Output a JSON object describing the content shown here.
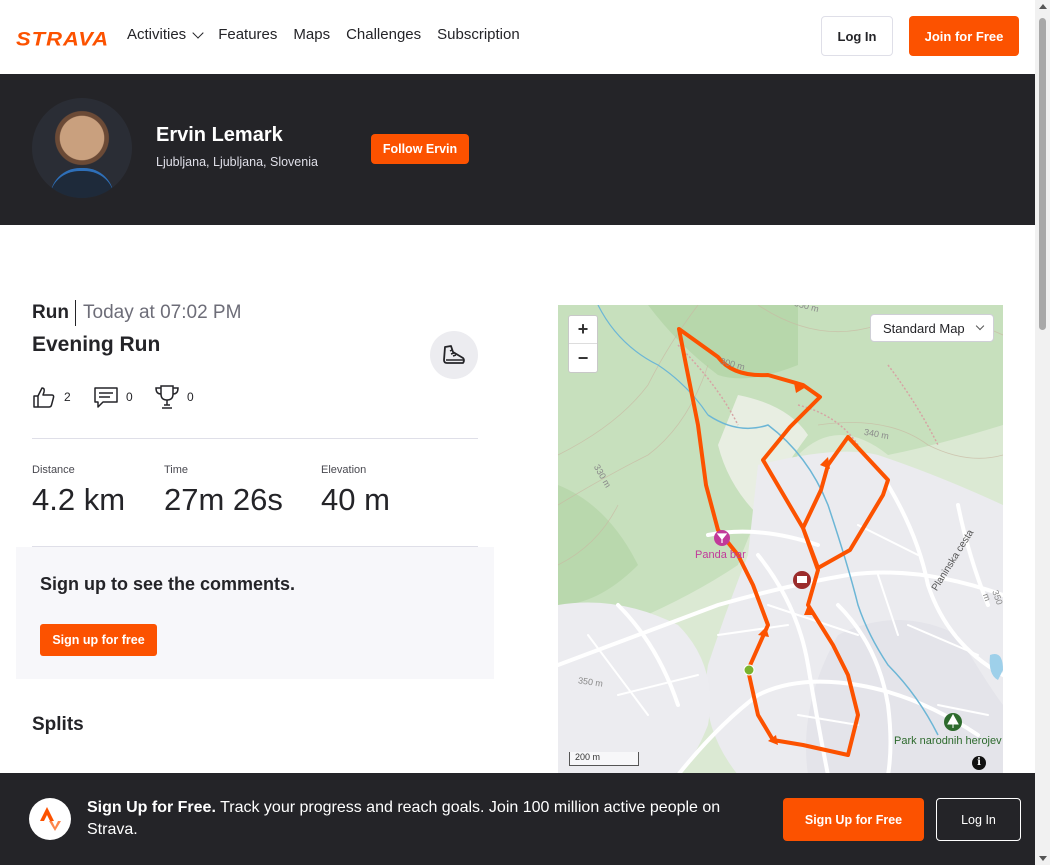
{
  "nav": {
    "logo": "STRAVA",
    "links": [
      "Activities",
      "Features",
      "Maps",
      "Challenges",
      "Subscription"
    ],
    "login_label": "Log In",
    "join_label": "Join for Free"
  },
  "athlete": {
    "name": "Ervin Lemark",
    "location": "Ljubljana, Ljubljana, Slovenia",
    "follow_label": "Follow Ervin"
  },
  "activity": {
    "type": "Run",
    "date": "Today at 07:02 PM",
    "name": "Evening Run",
    "kudos": "2",
    "comments": "0",
    "achievements": "0",
    "stats": [
      {
        "label": "Distance",
        "value": "4.2 km"
      },
      {
        "label": "Time",
        "value": "27m 26s"
      },
      {
        "label": "Elevation",
        "value": "40 m"
      }
    ]
  },
  "comments": {
    "title": "Sign up to see the comments.",
    "button": "Sign up for free"
  },
  "splits": {
    "title": "Splits"
  },
  "map": {
    "zoom_in": "+",
    "zoom_out": "−",
    "map_type": "Standard Map",
    "labels": {
      "poi_bar": "Panda bar",
      "park": "Park narodnih herojev",
      "street": "Planinska cesta",
      "c300": "300 m",
      "c330": "330 m",
      "c340": "340 m",
      "c350": "350 m",
      "c350b": "350 m",
      "c350c": "350 m"
    },
    "scale": "200 m",
    "info": "i",
    "route_color": "#fc5200"
  },
  "banner": {
    "headline": "Sign Up for Free.",
    "text": "Track your progress and reach goals. Join 100 million active people on Strava.",
    "signup_label": "Sign Up for Free",
    "login_label": "Log In"
  },
  "colors": {
    "brand": "#fc5200",
    "dark": "#242428"
  }
}
